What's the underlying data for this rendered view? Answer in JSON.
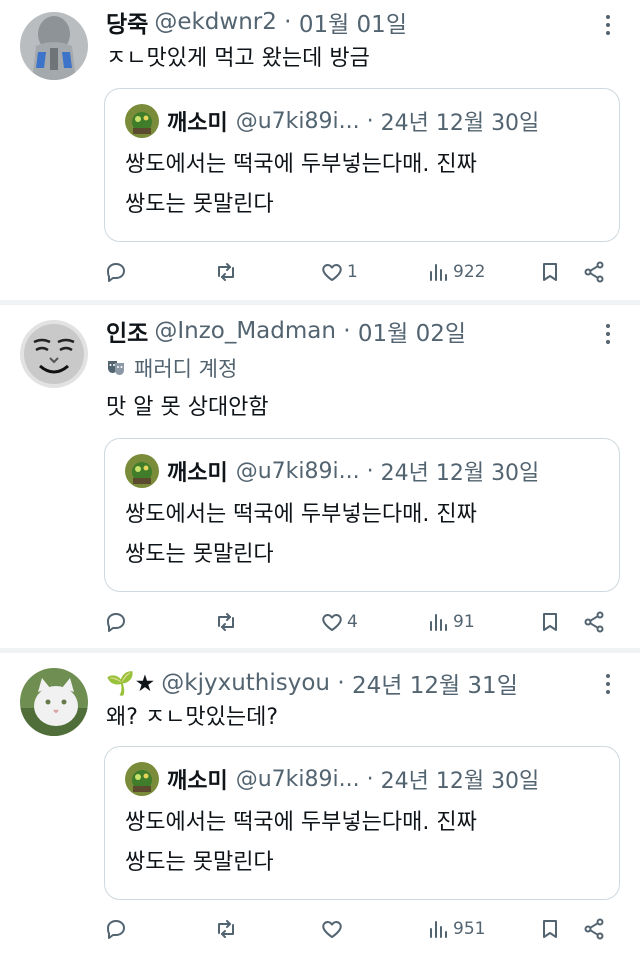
{
  "tweets": [
    {
      "name": "당죽",
      "handle": "@ekdwnr2",
      "date": "01월 01일",
      "text": "ㅈㄴ맛있게 먹고 왔는데 방금",
      "label": null,
      "quote": {
        "name": "깨소미",
        "handle": "@u7ki89i...",
        "date": "24년 12월 30일",
        "line1": "쌍도에서는 떡국에 두부넣는다매. 진짜",
        "line2": "쌍도는 못말린다"
      },
      "likes": "1",
      "views": "922"
    },
    {
      "name": "인조",
      "handle": "@Inzo_Madman",
      "date": "01월 02일",
      "label": "패러디 계정",
      "text": "맛 알 못 상대안함",
      "quote": {
        "name": "깨소미",
        "handle": "@u7ki89i...",
        "date": "24년 12월 30일",
        "line1": "쌍도에서는 떡국에 두부넣는다매. 진짜",
        "line2": "쌍도는 못말린다"
      },
      "likes": "4",
      "views": "91"
    },
    {
      "name": "🌱★",
      "handle": "@kjyxuthisyou",
      "date": "24년 12월 31일",
      "label": null,
      "text": "왜? ㅈㄴ맛있는데?",
      "quote": {
        "name": "깨소미",
        "handle": "@u7ki89i...",
        "date": "24년 12월 30일",
        "line1": "쌍도에서는 떡국에 두부넣는다매. 진짜",
        "line2": "쌍도는 못말린다"
      },
      "likes": "",
      "views": "951"
    }
  ],
  "separator": " · ",
  "colors": {
    "text_primary": "#0f1419",
    "text_secondary": "#536471",
    "border": "#cfd9de",
    "divider": "#eff3f4"
  },
  "icons": [
    "reply-icon",
    "retweet-icon",
    "like-icon",
    "views-icon",
    "bookmark-icon",
    "share-icon",
    "more-icon",
    "parody-mask-icon"
  ]
}
